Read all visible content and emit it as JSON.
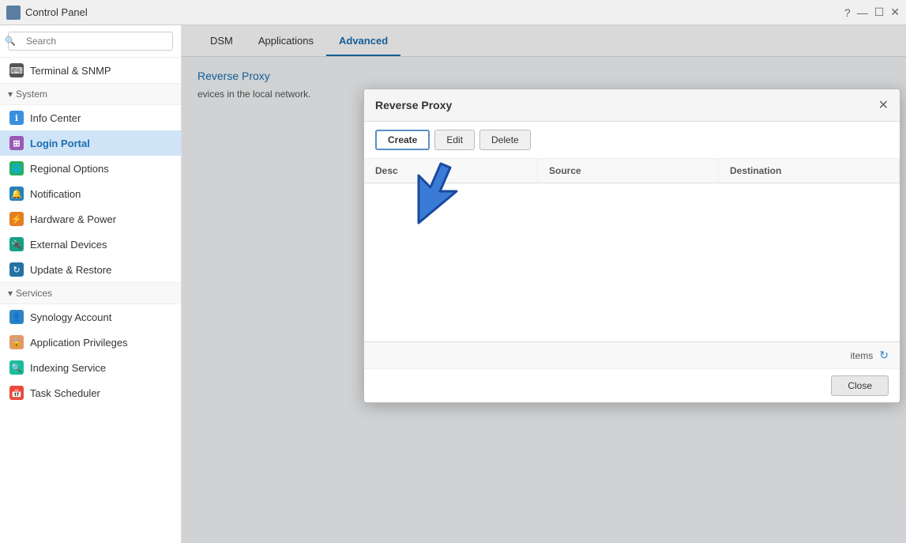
{
  "titlebar": {
    "title": "Control Panel",
    "controls": [
      "?",
      "—",
      "☐",
      "✕"
    ]
  },
  "sidebar": {
    "search_placeholder": "Search",
    "nav_item_terminal": "Terminal & SNMP",
    "section_system": "System",
    "items_system": [
      {
        "label": "Info Center",
        "icon_color": "icon-blue-info"
      },
      {
        "label": "Login Portal",
        "icon_color": "icon-purple-login",
        "active": true
      },
      {
        "label": "Regional Options",
        "icon_color": "icon-green-regional"
      },
      {
        "label": "Notification",
        "icon_color": "icon-blue-notif"
      },
      {
        "label": "Hardware & Power",
        "icon_color": "icon-orange-hw"
      },
      {
        "label": "External Devices",
        "icon_color": "icon-green-ext"
      },
      {
        "label": "Update & Restore",
        "icon_color": "icon-blue-update"
      }
    ],
    "section_services": "Services",
    "items_services": [
      {
        "label": "Synology Account",
        "icon_color": "icon-blue-synology"
      },
      {
        "label": "Application Privileges",
        "icon_color": "icon-orange-apppriv"
      },
      {
        "label": "Indexing Service",
        "icon_color": "icon-teal-index"
      },
      {
        "label": "Task Scheduler",
        "icon_color": "icon-red-task"
      }
    ]
  },
  "tabs": [
    {
      "label": "DSM",
      "active": false
    },
    {
      "label": "Applications",
      "active": false
    },
    {
      "label": "Advanced",
      "active": true
    }
  ],
  "content": {
    "subtitle": "Reverse Proxy",
    "description": "evices in the local network."
  },
  "dialog": {
    "title": "Reverse Proxy",
    "buttons": {
      "create": "Create",
      "edit": "Edit",
      "delete": "Delete"
    },
    "table_headers": {
      "description": "Desc",
      "source": "Source",
      "destination": "Destination"
    },
    "footer": {
      "items_label": "items"
    },
    "close_button": "Close"
  }
}
